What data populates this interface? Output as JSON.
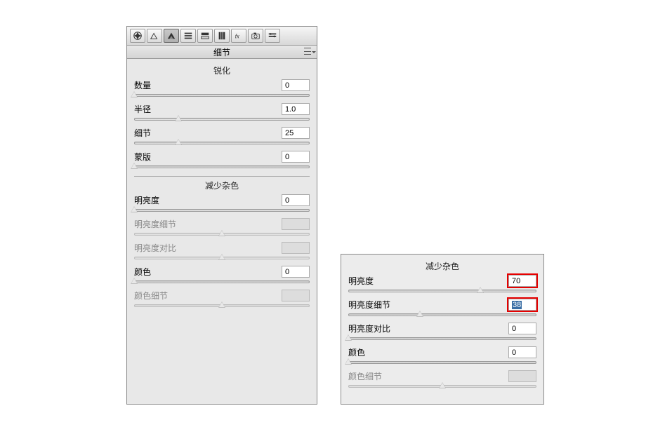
{
  "toolbar": {
    "icons": [
      "aperture-icon",
      "histogram-icon",
      "detail-icon",
      "hsl-icon",
      "split-icon",
      "lens-icon",
      "fx-icon",
      "camera-icon",
      "presets-icon"
    ]
  },
  "tab": {
    "title": "细节"
  },
  "main": {
    "sharpen": {
      "title": "锐化",
      "amount": {
        "label": "数量",
        "value": "0",
        "pos": 0
      },
      "radius": {
        "label": "半径",
        "value": "1.0",
        "pos": 25
      },
      "detail": {
        "label": "细节",
        "value": "25",
        "pos": 25
      },
      "mask": {
        "label": "蒙版",
        "value": "0",
        "pos": 0
      }
    },
    "noise": {
      "title": "减少杂色",
      "luminance": {
        "label": "明亮度",
        "value": "0",
        "pos": 0
      },
      "luminance_detail": {
        "label": "明亮度细节",
        "value": "",
        "pos": 50,
        "disabled": true
      },
      "luminance_contrast": {
        "label": "明亮度对比",
        "value": "",
        "pos": 50,
        "disabled": true
      },
      "color": {
        "label": "颜色",
        "value": "0",
        "pos": 0
      },
      "color_detail": {
        "label": "颜色细节",
        "value": "",
        "pos": 50,
        "disabled": true
      }
    }
  },
  "side": {
    "title": "减少杂色",
    "luminance": {
      "label": "明亮度",
      "value": "70",
      "pos": 70,
      "highlight": true
    },
    "luminance_detail": {
      "label": "明亮度细节",
      "value": "38",
      "pos": 38,
      "highlight": true,
      "selected": true
    },
    "luminance_contrast": {
      "label": "明亮度对比",
      "value": "0",
      "pos": 0
    },
    "color": {
      "label": "颜色",
      "value": "0",
      "pos": 0
    },
    "color_detail": {
      "label": "颜色细节",
      "value": "",
      "pos": 50,
      "disabled": true
    }
  }
}
